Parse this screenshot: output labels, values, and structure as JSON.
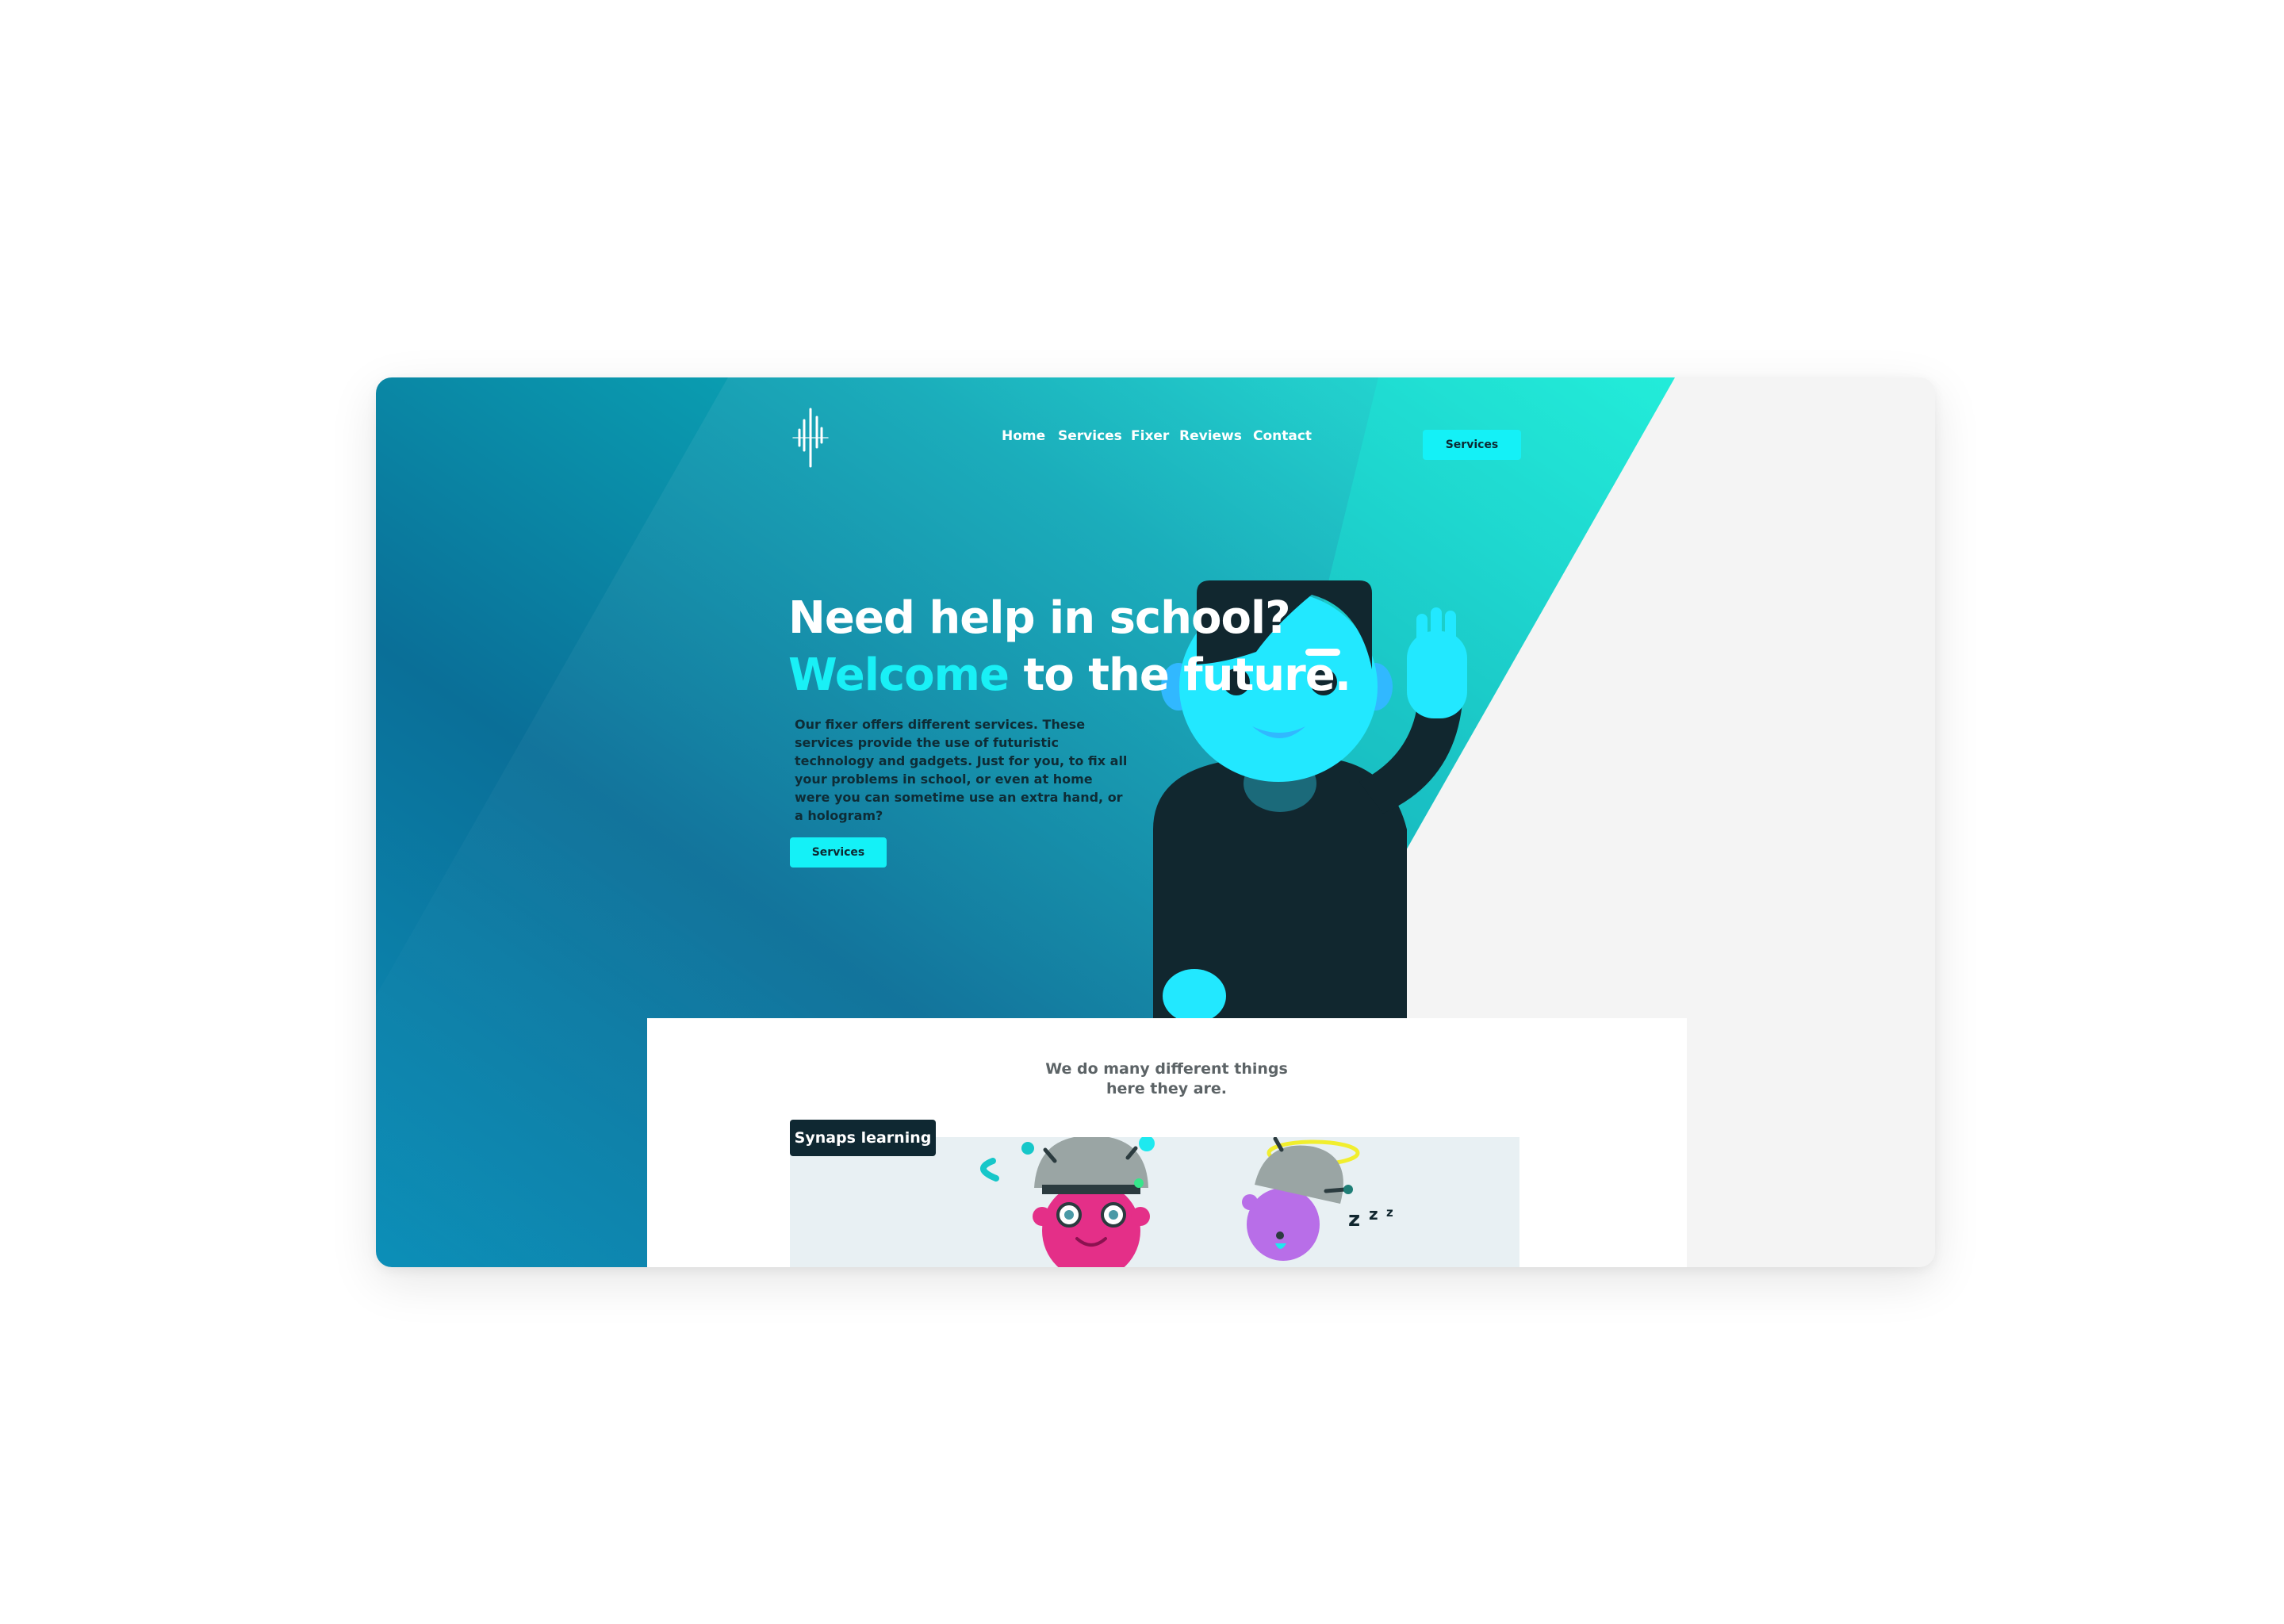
{
  "colors": {
    "gradient_dark": "#0b7fa6",
    "gradient_mid": "#0aa8b8",
    "gradient_light": "#12ead2",
    "accent_cyan": "#14f1f7",
    "dark_navy": "#0f2832",
    "page_bg": "#f4f4f4"
  },
  "header": {
    "logo_icon": "brain-wave-logo-icon",
    "nav": [
      {
        "label": "Home"
      },
      {
        "label": "Services"
      },
      {
        "label": "Fixer"
      },
      {
        "label": "Reviews"
      },
      {
        "label": "Contact"
      }
    ],
    "cta_label": "Services"
  },
  "hero": {
    "title_line1": "Need help in school?",
    "title_highlight": "Welcome",
    "title_rest": " to the future.",
    "description": "Our fixer offers different services. These services provide the use of futuristic technology and gadgets. Just for you, to fix all your problems in school, or even at home were you can sometime use an extra hand, or a hologram?",
    "button_label": "Services",
    "illustration": "waving-character-illustration"
  },
  "services_section": {
    "caption_line1": "We do many different things",
    "caption_line2": "here they are.",
    "first_service_tag": "Synaps learning",
    "illustration": "two-characters-with-helmets-illustration"
  }
}
